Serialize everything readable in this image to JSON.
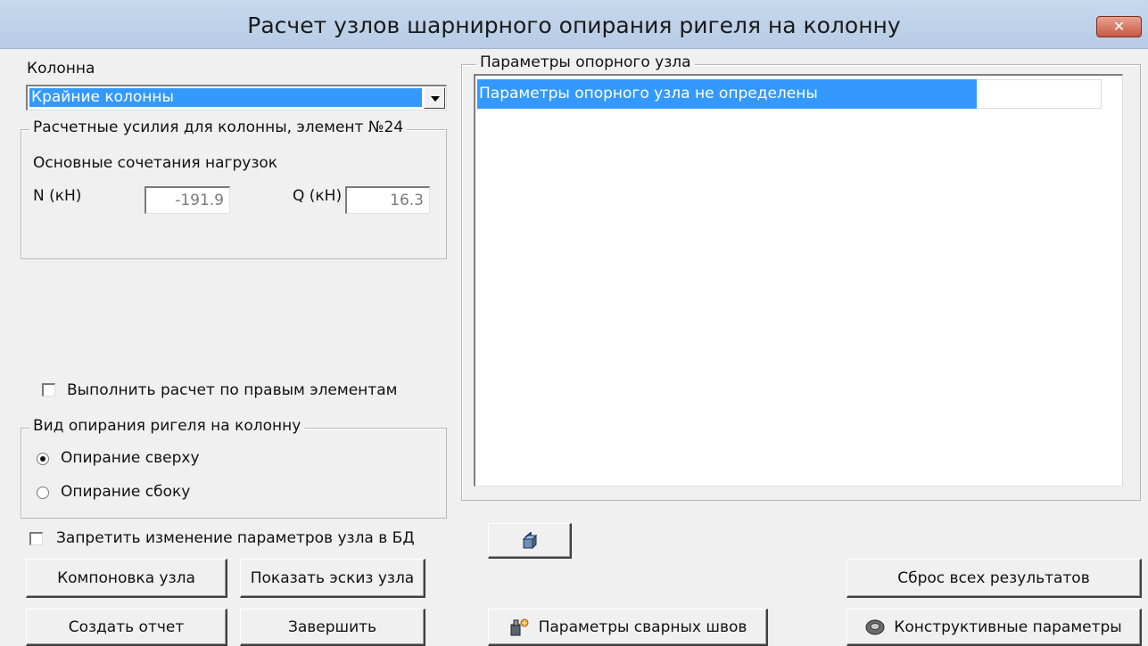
{
  "window": {
    "title": "Расчет узлов шарнирного опирания ригеля на колонну",
    "close_glyph": "✕"
  },
  "column": {
    "label": "Колонна",
    "selected": "Крайние колонны"
  },
  "forces": {
    "legend": "Расчетные усилия для колонны, элемент №24",
    "combo_label": "Основные сочетания нагрузок",
    "n_label": "N (кН)",
    "n_value": "-191.9",
    "q_label": "Q (кН)",
    "q_value": "16.3"
  },
  "right_elements": {
    "label": "Выполнить расчет по правым элементам",
    "checked": false
  },
  "support_type": {
    "legend": "Вид опирания ригеля на колонну",
    "options": [
      {
        "label": "Опирание сверху",
        "selected": true
      },
      {
        "label": "Опирание сбоку",
        "selected": false
      }
    ]
  },
  "forbid_db": {
    "label": "Запретить изменение параметров узла в БД",
    "checked": false
  },
  "node_params": {
    "legend": "Параметры опорного узла",
    "rows": [
      "Параметры опорного узла не определены"
    ]
  },
  "buttons": {
    "layout": "Компоновка узла",
    "sketch": "Показать эскиз узла",
    "report": "Создать отчет",
    "finish": "Завершить",
    "welds": "Параметры сварных швов",
    "reset": "Сброс всех результатов",
    "constructive": "Конструктивные параметры"
  },
  "icons": [
    "close-icon",
    "dropdown-arrow-icon",
    "3d-view-icon",
    "weld-icon",
    "gear-icon"
  ],
  "colors": {
    "selection": "#3399ff",
    "titlebar": "#c7d9ee",
    "close": "#c65a43"
  }
}
